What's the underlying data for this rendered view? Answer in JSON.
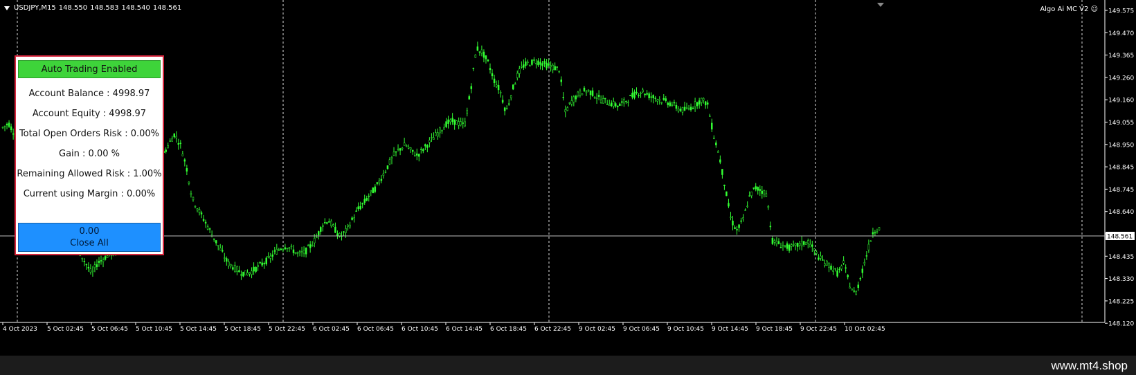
{
  "chart": {
    "symbol": "USDJPY,M15",
    "ohlc": [
      "148.550",
      "148.583",
      "148.540",
      "148.561"
    ],
    "indicator_label": "Algo Ai MC V2",
    "current_price_tag": "148.561",
    "y_ticks": [
      "149.575",
      "149.470",
      "149.365",
      "149.260",
      "149.160",
      "149.055",
      "148.950",
      "148.845",
      "148.745",
      "148.640",
      "148.535",
      "148.435",
      "148.330",
      "148.225",
      "148.120"
    ],
    "x_ticks": [
      "4 Oct 2023",
      "5 Oct 02:45",
      "5 Oct 06:45",
      "5 Oct 10:45",
      "5 Oct 14:45",
      "5 Oct 18:45",
      "5 Oct 22:45",
      "6 Oct 02:45",
      "6 Oct 06:45",
      "6 Oct 10:45",
      "6 Oct 14:45",
      "6 Oct 18:45",
      "6 Oct 22:45",
      "9 Oct 02:45",
      "9 Oct 06:45",
      "9 Oct 10:45",
      "9 Oct 14:45",
      "9 Oct 18:45",
      "9 Oct 22:45",
      "10 Oct 02:45"
    ]
  },
  "panel": {
    "status_label": "Auto Trading Enabled",
    "account_balance": "Account Balance : 4998.97",
    "account_equity": "Account Equity : 4998.97",
    "open_orders_risk": "Total Open Orders Risk : 0.00%",
    "gain": "Gain : 0.00 %",
    "remaining_risk": "Remaining Allowed Risk : 1.00%",
    "current_margin": "Current using Margin : 0.00%",
    "close_value": "0.00",
    "close_label": "Close All"
  },
  "footer": {
    "watermark": "www.mt4.shop"
  },
  "colors": {
    "candle": "#33ff33",
    "background": "#000000",
    "panel_border": "#d7263d",
    "status_green": "#3ed43a",
    "close_blue": "#1e90ff"
  },
  "chart_data": {
    "type": "candlestick",
    "price_series": [
      149.03,
      149.05,
      149.0,
      148.98,
      148.95,
      148.9,
      148.85,
      148.8,
      148.78,
      148.75,
      148.7,
      148.6,
      148.5,
      148.45,
      148.4,
      148.35,
      148.4,
      148.42,
      148.44,
      148.45,
      148.5,
      148.55,
      148.6,
      148.7,
      148.75,
      148.8,
      148.85,
      148.9,
      148.95,
      149.0,
      148.95,
      148.85,
      148.7,
      148.65,
      148.6,
      148.55,
      148.5,
      148.45,
      148.4,
      148.38,
      148.36,
      148.35,
      148.36,
      148.38,
      148.4,
      148.42,
      148.45,
      148.47,
      148.48,
      148.46,
      148.44,
      148.45,
      148.48,
      148.52,
      148.58,
      148.6,
      148.56,
      148.52,
      148.55,
      148.6,
      148.65,
      148.68,
      148.72,
      148.75,
      148.8,
      148.85,
      148.9,
      148.93,
      148.95,
      148.92,
      148.9,
      148.93,
      148.96,
      148.99,
      149.02,
      149.05,
      149.06,
      149.05,
      149.04,
      149.2,
      149.4,
      149.38,
      149.33,
      149.25,
      149.2,
      149.1,
      149.2,
      149.28,
      149.32,
      149.33,
      149.34,
      149.33,
      149.32,
      149.31,
      149.3,
      149.1,
      149.15,
      149.18,
      149.2,
      149.2,
      149.18,
      149.16,
      149.15,
      149.14,
      149.13,
      149.15,
      149.17,
      149.19,
      149.2,
      149.18,
      149.17,
      149.16,
      149.15,
      149.14,
      149.12,
      149.11,
      149.12,
      149.14,
      149.16,
      149.14,
      149.0,
      148.9,
      148.75,
      148.6,
      148.55,
      148.6,
      148.7,
      148.75,
      148.74,
      148.72,
      148.5,
      148.49,
      148.48,
      148.47,
      148.48,
      148.49,
      148.5,
      148.46,
      148.42,
      148.4,
      148.38,
      148.35,
      148.4,
      148.3,
      148.25,
      148.35,
      148.45,
      148.55,
      148.56
    ]
  }
}
